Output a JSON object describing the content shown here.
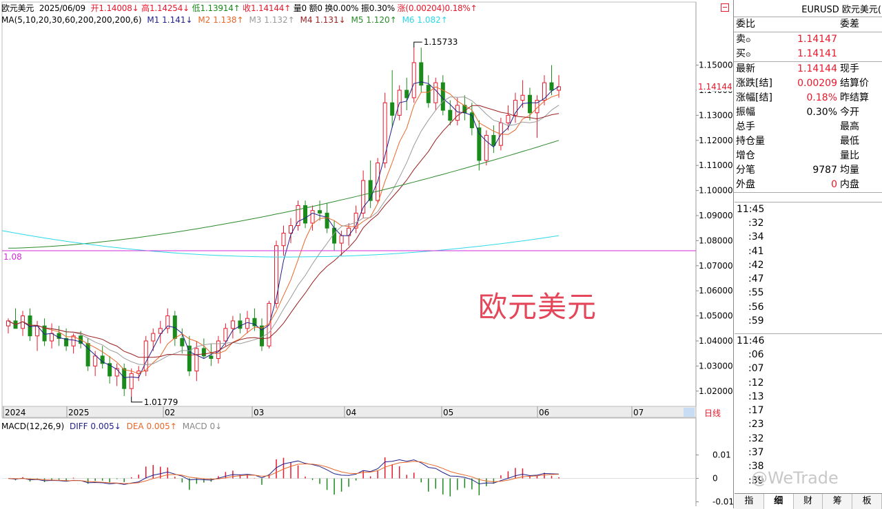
{
  "info_bar": {
    "name": "欧元美元",
    "date": "2025/06/09",
    "open": "开1.14008↓",
    "high": "高1.14254↓",
    "low": "低1.13914↑",
    "close": "收1.14144↑",
    "volume": "量0",
    "amount": "额0",
    "turnover": "换0.00%",
    "amplitude": "振0.30%",
    "change": "涨(0.00204)0.18%↑"
  },
  "ma_bar": {
    "label": "MA(5,10,20,30,60,200,200,200,6)",
    "m1": "M1 1.141↓",
    "m2": "M2 1.138↑",
    "m3": "M3 1.132↑",
    "m4": "M4 1.131↓",
    "m5": "M5 1.120↑",
    "m6": "M6 1.082↑"
  },
  "macd_bar": {
    "label": "MACD(12,26,9)",
    "diff": "DIFF 0.005↓",
    "dea": "DEA 0.005↑",
    "macd": "MACD 0↓"
  },
  "colors": {
    "up": "#e8172a",
    "down": "#1a8a1a",
    "m1": "#1f1f8a",
    "m2": "#e8672a",
    "m3": "#9a9a9a",
    "m4": "#9a1f1f",
    "m5": "#2a8a2a",
    "m6": "#2ad8e8",
    "hline": "#d22ad8"
  },
  "chart_annotations": {
    "high_label": "1.15733",
    "low_label": "1.01779",
    "hline_label": "1.08",
    "overlay_title": "欧元美元"
  },
  "chart_data": {
    "type": "candlestick",
    "x_ticks": [
      "2024",
      "2025",
      "02",
      "03",
      "04",
      "05",
      "06",
      "07"
    ],
    "y_ticks": [
      "1.15000",
      "1.14000",
      "1.13000",
      "1.12000",
      "1.11000",
      "1.10000",
      "1.09000",
      "1.08000",
      "1.07000",
      "1.06000",
      "1.05000",
      "1.04000",
      "1.03000",
      "1.02000"
    ],
    "y_range": [
      1.015,
      1.165
    ],
    "current_price": "1.14144",
    "macd_y_ticks": [
      "0.01",
      "0",
      "-0.01"
    ],
    "macd_range": [
      -0.011,
      0.019
    ],
    "candles": [
      {
        "o": 1.046,
        "h": 1.049,
        "l": 1.043,
        "c": 1.048
      },
      {
        "o": 1.048,
        "h": 1.053,
        "l": 1.046,
        "c": 1.045
      },
      {
        "o": 1.045,
        "h": 1.052,
        "l": 1.042,
        "c": 1.05
      },
      {
        "o": 1.05,
        "h": 1.053,
        "l": 1.04,
        "c": 1.042
      },
      {
        "o": 1.042,
        "h": 1.048,
        "l": 1.036,
        "c": 1.046
      },
      {
        "o": 1.046,
        "h": 1.049,
        "l": 1.038,
        "c": 1.04
      },
      {
        "o": 1.04,
        "h": 1.047,
        "l": 1.037,
        "c": 1.043
      },
      {
        "o": 1.043,
        "h": 1.046,
        "l": 1.038,
        "c": 1.041
      },
      {
        "o": 1.041,
        "h": 1.045,
        "l": 1.036,
        "c": 1.038
      },
      {
        "o": 1.038,
        "h": 1.043,
        "l": 1.035,
        "c": 1.042
      },
      {
        "o": 1.042,
        "h": 1.044,
        "l": 1.037,
        "c": 1.039
      },
      {
        "o": 1.039,
        "h": 1.041,
        "l": 1.028,
        "c": 1.03
      },
      {
        "o": 1.03,
        "h": 1.036,
        "l": 1.026,
        "c": 1.034
      },
      {
        "o": 1.034,
        "h": 1.038,
        "l": 1.029,
        "c": 1.031
      },
      {
        "o": 1.031,
        "h": 1.034,
        "l": 1.023,
        "c": 1.026
      },
      {
        "o": 1.026,
        "h": 1.031,
        "l": 1.022,
        "c": 1.029
      },
      {
        "o": 1.029,
        "h": 1.031,
        "l": 1.018,
        "c": 1.021
      },
      {
        "o": 1.021,
        "h": 1.029,
        "l": 1.0178,
        "c": 1.027
      },
      {
        "o": 1.027,
        "h": 1.03,
        "l": 1.024,
        "c": 1.028
      },
      {
        "o": 1.028,
        "h": 1.042,
        "l": 1.026,
        "c": 1.04
      },
      {
        "o": 1.04,
        "h": 1.045,
        "l": 1.036,
        "c": 1.043
      },
      {
        "o": 1.043,
        "h": 1.048,
        "l": 1.039,
        "c": 1.045
      },
      {
        "o": 1.045,
        "h": 1.053,
        "l": 1.043,
        "c": 1.05
      },
      {
        "o": 1.05,
        "h": 1.052,
        "l": 1.038,
        "c": 1.041
      },
      {
        "o": 1.041,
        "h": 1.045,
        "l": 1.035,
        "c": 1.038
      },
      {
        "o": 1.038,
        "h": 1.042,
        "l": 1.026,
        "c": 1.028
      },
      {
        "o": 1.028,
        "h": 1.04,
        "l": 1.024,
        "c": 1.037
      },
      {
        "o": 1.037,
        "h": 1.041,
        "l": 1.033,
        "c": 1.034
      },
      {
        "o": 1.034,
        "h": 1.039,
        "l": 1.03,
        "c": 1.033
      },
      {
        "o": 1.033,
        "h": 1.042,
        "l": 1.031,
        "c": 1.04
      },
      {
        "o": 1.04,
        "h": 1.047,
        "l": 1.038,
        "c": 1.045
      },
      {
        "o": 1.045,
        "h": 1.05,
        "l": 1.041,
        "c": 1.048
      },
      {
        "o": 1.048,
        "h": 1.051,
        "l": 1.043,
        "c": 1.045
      },
      {
        "o": 1.045,
        "h": 1.052,
        "l": 1.043,
        "c": 1.049
      },
      {
        "o": 1.049,
        "h": 1.053,
        "l": 1.044,
        "c": 1.046
      },
      {
        "o": 1.046,
        "h": 1.049,
        "l": 1.036,
        "c": 1.038
      },
      {
        "o": 1.038,
        "h": 1.056,
        "l": 1.037,
        "c": 1.055
      },
      {
        "o": 1.055,
        "h": 1.08,
        "l": 1.053,
        "c": 1.078
      },
      {
        "o": 1.078,
        "h": 1.086,
        "l": 1.074,
        "c": 1.083
      },
      {
        "o": 1.083,
        "h": 1.089,
        "l": 1.079,
        "c": 1.086
      },
      {
        "o": 1.086,
        "h": 1.096,
        "l": 1.084,
        "c": 1.094
      },
      {
        "o": 1.094,
        "h": 1.096,
        "l": 1.085,
        "c": 1.087
      },
      {
        "o": 1.087,
        "h": 1.094,
        "l": 1.084,
        "c": 1.092
      },
      {
        "o": 1.092,
        "h": 1.096,
        "l": 1.088,
        "c": 1.091
      },
      {
        "o": 1.091,
        "h": 1.095,
        "l": 1.083,
        "c": 1.085
      },
      {
        "o": 1.085,
        "h": 1.088,
        "l": 1.076,
        "c": 1.079
      },
      {
        "o": 1.079,
        "h": 1.084,
        "l": 1.074,
        "c": 1.082
      },
      {
        "o": 1.082,
        "h": 1.087,
        "l": 1.078,
        "c": 1.085
      },
      {
        "o": 1.085,
        "h": 1.094,
        "l": 1.083,
        "c": 1.091
      },
      {
        "o": 1.091,
        "h": 1.108,
        "l": 1.089,
        "c": 1.104
      },
      {
        "o": 1.104,
        "h": 1.112,
        "l": 1.093,
        "c": 1.096
      },
      {
        "o": 1.096,
        "h": 1.113,
        "l": 1.095,
        "c": 1.111
      },
      {
        "o": 1.111,
        "h": 1.139,
        "l": 1.109,
        "c": 1.135
      },
      {
        "o": 1.135,
        "h": 1.148,
        "l": 1.125,
        "c": 1.13
      },
      {
        "o": 1.13,
        "h": 1.142,
        "l": 1.128,
        "c": 1.14
      },
      {
        "o": 1.14,
        "h": 1.145,
        "l": 1.132,
        "c": 1.137
      },
      {
        "o": 1.137,
        "h": 1.157,
        "l": 1.135,
        "c": 1.151
      },
      {
        "o": 1.151,
        "h": 1.157,
        "l": 1.139,
        "c": 1.142
      },
      {
        "o": 1.142,
        "h": 1.146,
        "l": 1.133,
        "c": 1.135
      },
      {
        "o": 1.135,
        "h": 1.145,
        "l": 1.132,
        "c": 1.143
      },
      {
        "o": 1.143,
        "h": 1.146,
        "l": 1.13,
        "c": 1.132
      },
      {
        "o": 1.132,
        "h": 1.136,
        "l": 1.126,
        "c": 1.128
      },
      {
        "o": 1.128,
        "h": 1.137,
        "l": 1.126,
        "c": 1.134
      },
      {
        "o": 1.134,
        "h": 1.138,
        "l": 1.128,
        "c": 1.131
      },
      {
        "o": 1.131,
        "h": 1.135,
        "l": 1.122,
        "c": 1.125
      },
      {
        "o": 1.125,
        "h": 1.128,
        "l": 1.108,
        "c": 1.112
      },
      {
        "o": 1.112,
        "h": 1.124,
        "l": 1.11,
        "c": 1.122
      },
      {
        "o": 1.122,
        "h": 1.126,
        "l": 1.115,
        "c": 1.118
      },
      {
        "o": 1.118,
        "h": 1.129,
        "l": 1.116,
        "c": 1.127
      },
      {
        "o": 1.127,
        "h": 1.134,
        "l": 1.124,
        "c": 1.13
      },
      {
        "o": 1.13,
        "h": 1.139,
        "l": 1.127,
        "c": 1.136
      },
      {
        "o": 1.136,
        "h": 1.144,
        "l": 1.133,
        "c": 1.138
      },
      {
        "o": 1.138,
        "h": 1.141,
        "l": 1.128,
        "c": 1.131
      },
      {
        "o": 1.131,
        "h": 1.138,
        "l": 1.121,
        "c": 1.136
      },
      {
        "o": 1.136,
        "h": 1.146,
        "l": 1.134,
        "c": 1.143
      },
      {
        "o": 1.143,
        "h": 1.15,
        "l": 1.138,
        "c": 1.14
      },
      {
        "o": 1.14,
        "h": 1.146,
        "l": 1.137,
        "c": 1.1414
      }
    ],
    "ma_lines": [
      {
        "name": "M1",
        "color": "#1f1f8a",
        "start": 1.05,
        "end": 1.141
      },
      {
        "name": "M2",
        "color": "#e8672a",
        "start": 1.052,
        "end": 1.138
      },
      {
        "name": "M3",
        "color": "#9a9a9a",
        "start": 1.054,
        "end": 1.132
      },
      {
        "name": "M4",
        "color": "#9a1f1f",
        "start": 1.056,
        "end": 1.131
      },
      {
        "name": "M5",
        "color": "#2a8a2a",
        "start": 1.077,
        "end": 1.12
      },
      {
        "name": "M6",
        "color": "#2ad8e8",
        "start": 1.084,
        "end": 1.082
      }
    ],
    "hline_value": 1.076
  },
  "panel": {
    "header": "EURUSD 欧元美元(",
    "wei_bi": "委比",
    "wei_cha": "委差",
    "sell_label": "卖",
    "sell_value": "1.14147",
    "buy_label": "买",
    "buy_value": "1.14141",
    "rows": [
      {
        "l": "最新",
        "v": "1.14144",
        "red": true,
        "l2": "现手",
        "r2": ""
      },
      {
        "l": "涨跌[结]",
        "v": "0.00209",
        "red": true,
        "l2": "结算价",
        "r2": ""
      },
      {
        "l": "涨幅[结]",
        "v": "0.18%",
        "red": true,
        "l2": "昨结算",
        "r2": ""
      },
      {
        "l": "振幅",
        "v": "0.30%",
        "red": false,
        "l2": "今开",
        "r2": ""
      },
      {
        "l": "总手",
        "v": "",
        "red": false,
        "l2": "最高",
        "r2": ""
      },
      {
        "l": "持仓量",
        "v": "",
        "red": false,
        "l2": "最低",
        "r2": ""
      },
      {
        "l": "增仓",
        "v": "",
        "red": false,
        "l2": "量比",
        "r2": ""
      },
      {
        "l": "分笔",
        "v": "9787",
        "red": false,
        "l2": "均量",
        "r2": ""
      },
      {
        "l": "外盘",
        "v": "0",
        "red": true,
        "l2": "内盘",
        "r2": ""
      }
    ],
    "time_block_1": {
      "head": "11:45",
      "rows": [
        ":32",
        ":34",
        ":41",
        ":42",
        ":47",
        ":55",
        ":56",
        ":59"
      ]
    },
    "time_block_2": {
      "head": "11:46",
      "rows": [
        ":06",
        ":07",
        ":12",
        ":13",
        ":17",
        ":23",
        ":32",
        ":37",
        ":38",
        ":39"
      ]
    },
    "tabs": [
      "指",
      "细",
      "财",
      "筹",
      "板"
    ],
    "day_button": "日线"
  },
  "watermark": "@WeTrade"
}
